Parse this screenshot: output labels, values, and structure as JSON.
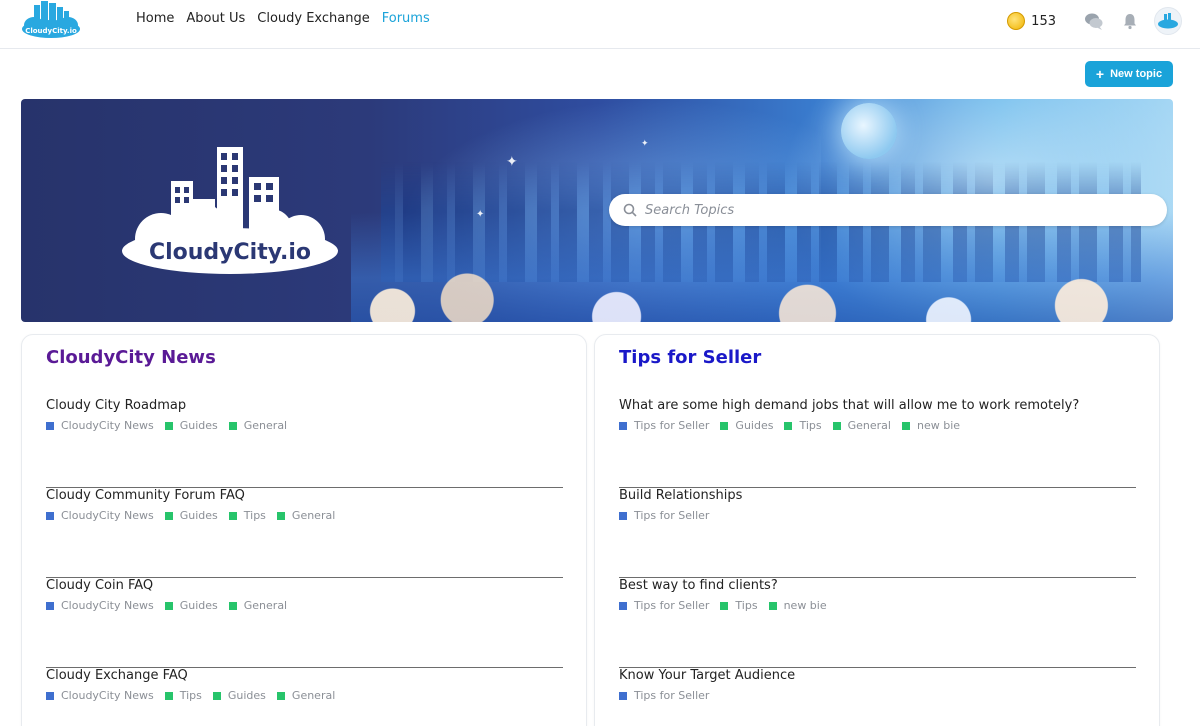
{
  "header": {
    "logo_text": "CloudyCity.io",
    "nav": [
      {
        "label": "Home",
        "active": false
      },
      {
        "label": "About Us",
        "active": false
      },
      {
        "label": "Cloudy Exchange",
        "active": false
      },
      {
        "label": "Forums",
        "active": true
      }
    ],
    "coin_count": "153",
    "icons": [
      "coin-icon",
      "chat-icon",
      "bell-icon",
      "avatar"
    ]
  },
  "new_topic_label": "New topic",
  "hero": {
    "logo_text": "CloudyCity.io",
    "search_placeholder": "Search Topics"
  },
  "colors": {
    "accent": "#1aa3d9",
    "news_title": "#5a1a96",
    "tips_title": "#1a18c8",
    "tag_category": "#3f6fcf",
    "tag_label": "#27c46b"
  },
  "columns": [
    {
      "title": "CloudyCity News",
      "topics": [
        {
          "title": "Cloudy City Roadmap",
          "tags": [
            {
              "label": "CloudyCity News",
              "color": "blue"
            },
            {
              "label": "Guides",
              "color": "green"
            },
            {
              "label": "General",
              "color": "green"
            }
          ]
        },
        {
          "title": "Cloudy Community Forum FAQ",
          "tags": [
            {
              "label": "CloudyCity News",
              "color": "blue"
            },
            {
              "label": "Guides",
              "color": "green"
            },
            {
              "label": "Tips",
              "color": "green"
            },
            {
              "label": "General",
              "color": "green"
            }
          ]
        },
        {
          "title": "Cloudy Coin FAQ",
          "tags": [
            {
              "label": "CloudyCity News",
              "color": "blue"
            },
            {
              "label": "Guides",
              "color": "green"
            },
            {
              "label": "General",
              "color": "green"
            }
          ]
        },
        {
          "title": "Cloudy Exchange FAQ",
          "tags": [
            {
              "label": "CloudyCity News",
              "color": "blue"
            },
            {
              "label": "Tips",
              "color": "green"
            },
            {
              "label": "Guides",
              "color": "green"
            },
            {
              "label": "General",
              "color": "green"
            }
          ]
        }
      ]
    },
    {
      "title": "Tips for Seller",
      "topics": [
        {
          "title": "What are some high demand jobs that will allow me to work remotely?",
          "tags": [
            {
              "label": "Tips for Seller",
              "color": "blue"
            },
            {
              "label": "Guides",
              "color": "green"
            },
            {
              "label": "Tips",
              "color": "green"
            },
            {
              "label": "General",
              "color": "green"
            },
            {
              "label": "new bie",
              "color": "green"
            }
          ]
        },
        {
          "title": "Build Relationships",
          "tags": [
            {
              "label": "Tips for Seller",
              "color": "blue"
            }
          ]
        },
        {
          "title": "Best way to find clients?",
          "tags": [
            {
              "label": "Tips for Seller",
              "color": "blue"
            },
            {
              "label": "Tips",
              "color": "green"
            },
            {
              "label": "new bie",
              "color": "green"
            }
          ]
        },
        {
          "title": "Know Your Target Audience",
          "tags": [
            {
              "label": "Tips for Seller",
              "color": "blue"
            }
          ]
        }
      ]
    }
  ]
}
